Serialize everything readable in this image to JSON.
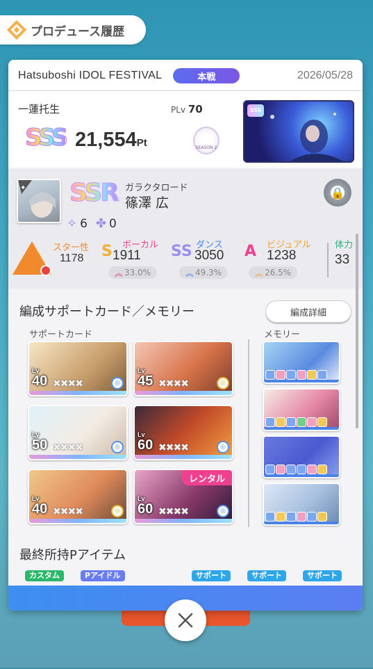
{
  "header": {
    "title": "プロデュース履歴",
    "icon": "produce-history-icon"
  },
  "event": {
    "name": "Hatsuboshi IDOL FESTIVAL",
    "badge": "本戦",
    "date": "2026/05/28"
  },
  "result": {
    "plan_name": "一蓮托生",
    "plv_label": "PLv",
    "plv_value": "70",
    "rank": "SSS",
    "score": "21,554",
    "score_unit": "Pt",
    "season_label": "SEASON 2"
  },
  "idol": {
    "rarity": "SSR",
    "card_title": "ガラクタロード",
    "name": "篠澤 広",
    "stars": "6",
    "clovers": "0"
  },
  "stats": {
    "star": {
      "label": "スター性",
      "value": "1178"
    },
    "vocal": {
      "label": "ボーカル",
      "value": "1911",
      "percent": "33.0%"
    },
    "dance": {
      "label": "ダンス",
      "value": "3050",
      "percent": "49.3%"
    },
    "visual": {
      "label": "ビジュアル",
      "value": "1238",
      "percent": "26.5%"
    },
    "stamina": {
      "label": "体力",
      "value": "33"
    }
  },
  "support": {
    "title": "編成サポートカード／メモリー",
    "detail_button": "編成詳細",
    "cards_label": "サポートカード",
    "memory_label": "メモリー",
    "rental_label": "レンタル",
    "cards": [
      {
        "lv": "40",
        "type": "blue"
      },
      {
        "lv": "45",
        "type": "gold"
      },
      {
        "lv": "50",
        "type": "blue"
      },
      {
        "lv": "60",
        "type": "blue"
      },
      {
        "lv": "40",
        "type": "gold"
      },
      {
        "lv": "60",
        "type": "blue"
      }
    ]
  },
  "items": {
    "title": "最終所持Pアイテム",
    "tags": [
      "カスタム",
      "Pアイドル",
      "サポート",
      "サポート",
      "サポート"
    ]
  },
  "colors": {
    "accent": "#5b6cf0",
    "custom_tag": "#2cb86a",
    "idol_tag": "#6a7df0",
    "support_tag": "#2ea6e8",
    "rental": "#f04090",
    "vocal": "#e8457a",
    "dance": "#4a8ae8",
    "visual": "#f0a030",
    "star": "#f08a2c"
  }
}
